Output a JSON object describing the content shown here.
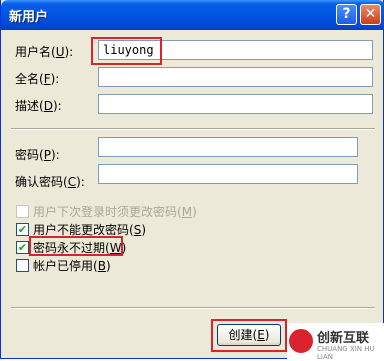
{
  "window": {
    "title": "新用户",
    "help": "?",
    "close": "✕"
  },
  "fields": {
    "username": {
      "label": "用户名",
      "key": "U",
      "value": "liuyong"
    },
    "fullname": {
      "label": "全名",
      "key": "F",
      "value": ""
    },
    "description": {
      "label": "描述",
      "key": "D",
      "value": ""
    },
    "password": {
      "label": "密码",
      "key": "P",
      "value": ""
    },
    "confirm": {
      "label": "确认密码",
      "key": "C",
      "value": ""
    }
  },
  "options": {
    "must_change": {
      "label": "用户下次登录时须更改密码",
      "key": "M",
      "checked": false,
      "mark": ""
    },
    "cannot_change": {
      "label": "用户不能更改密码",
      "key": "S",
      "checked": true,
      "mark": "✔"
    },
    "never_expires": {
      "label": "密码永不过期",
      "key": "W",
      "checked": true,
      "mark": "✔"
    },
    "disabled": {
      "label": "帐户已停用",
      "key": "B",
      "checked": false,
      "mark": ""
    }
  },
  "buttons": {
    "create": {
      "label": "创建",
      "key": "E"
    }
  },
  "watermark": {
    "text": "创新互联",
    "sub": "CHUANG XIN HU LIAN"
  },
  "colors": {
    "title_bar": "#0055e5",
    "highlight": "#d9232e",
    "check": "#21a121"
  }
}
